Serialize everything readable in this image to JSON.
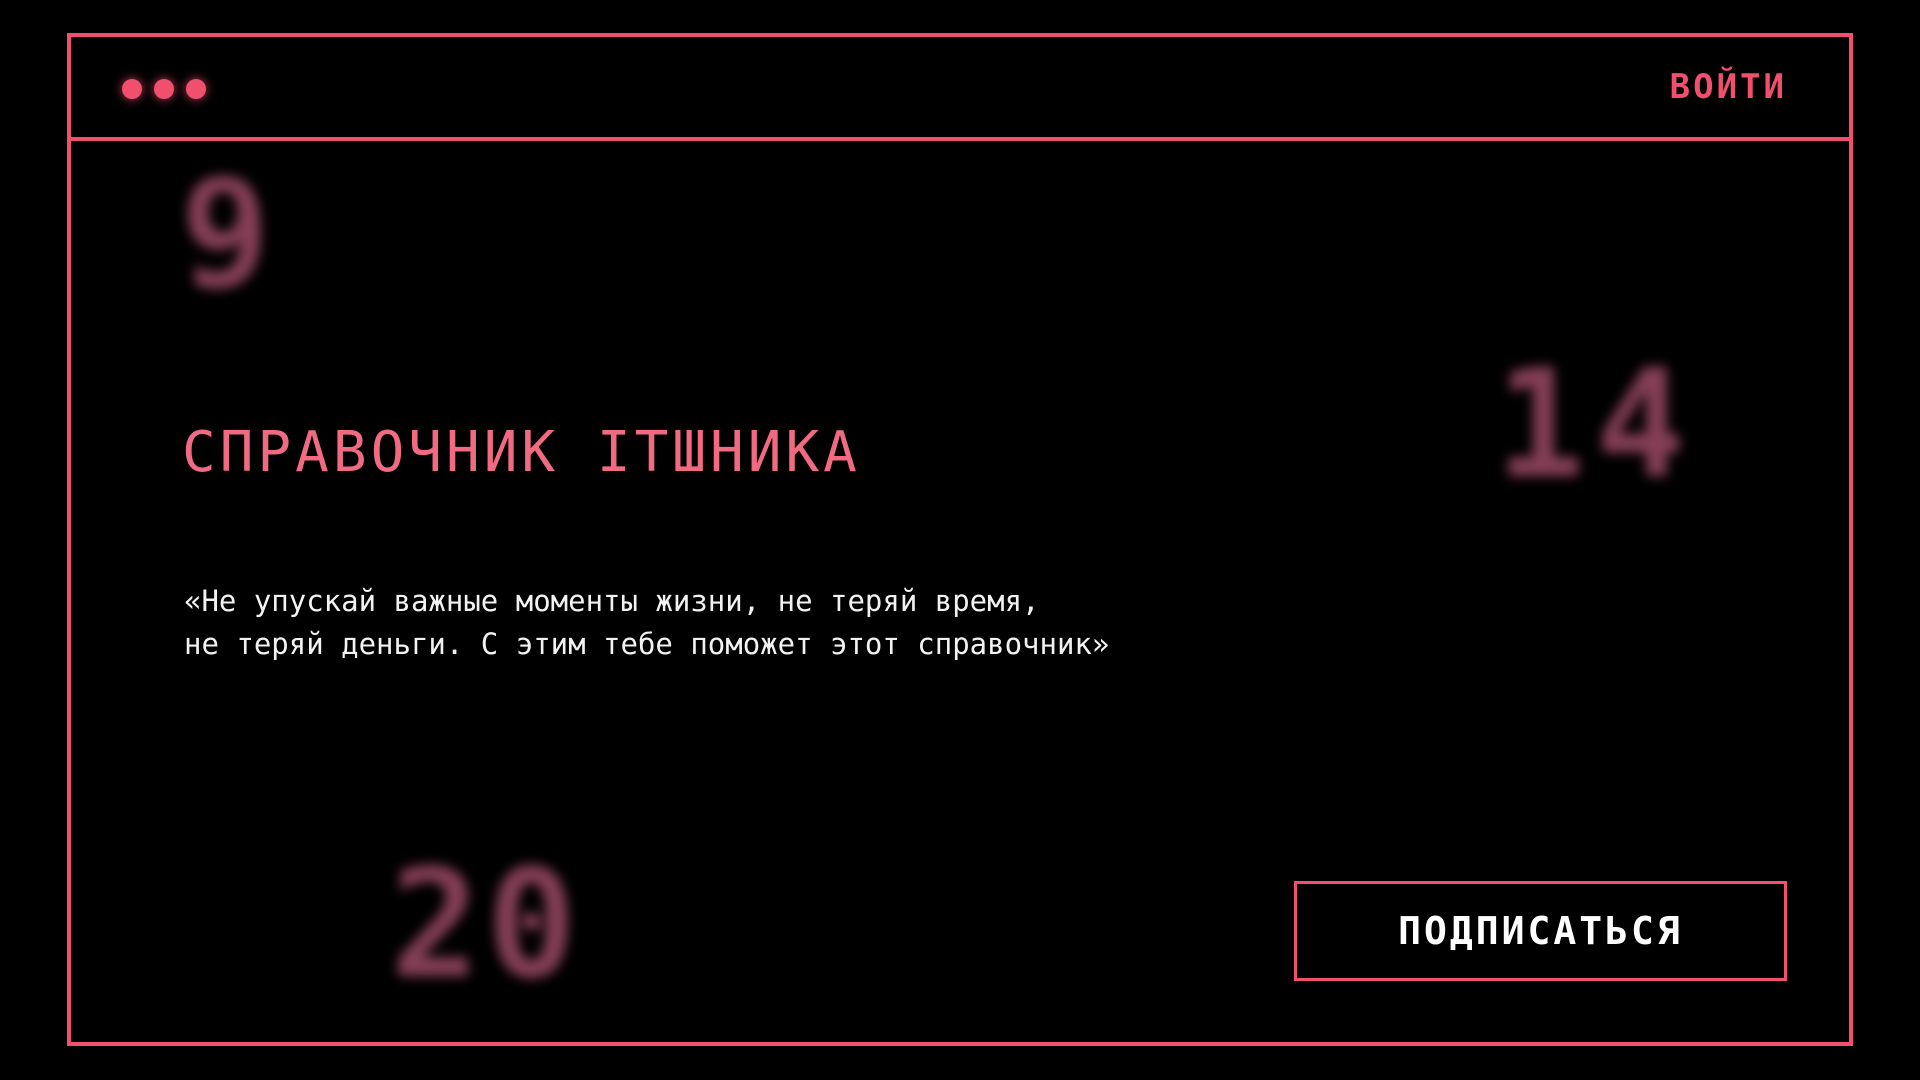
{
  "window": {
    "titlebar": {
      "dots_count": 3,
      "login_label": "ВОЙТИ"
    }
  },
  "background_numbers": [
    "9",
    "14",
    "20"
  ],
  "main": {
    "title": "СПРАВОЧНИК ITШНИКА",
    "quote_line1": "«Не упускай важные моменты жизни, не теряй время,",
    "quote_line2": "не теряй деньги. С этим тебе поможет этот справочник»",
    "subscribe_label": "ПОДПИСАТЬСЯ"
  },
  "colors": {
    "accent": "#f0506e",
    "title": "#f06a82",
    "background": "#000000",
    "text": "#f2f2f2",
    "blurred_numbers": "#9c4a65"
  },
  "icons": {
    "window_controls": "three-dot-icon"
  }
}
